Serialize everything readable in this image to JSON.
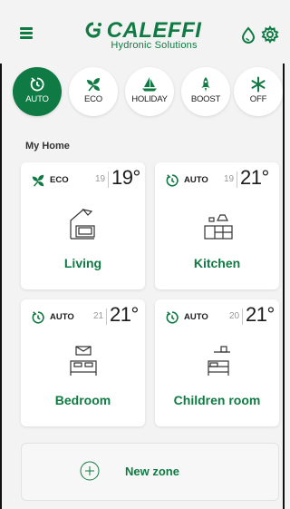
{
  "header": {
    "brand": "CALEFFI",
    "subtitle": "Hydronic Solutions",
    "brand_color": "#0f7a43"
  },
  "modes": [
    {
      "label": "AUTO",
      "icon": "auto-icon",
      "active": true
    },
    {
      "label": "ECO",
      "icon": "eco-icon",
      "active": false
    },
    {
      "label": "HOLIDAY",
      "icon": "sailboat-icon",
      "active": false
    },
    {
      "label": "BOOST",
      "icon": "rocket-icon",
      "active": false
    },
    {
      "label": "OFF",
      "icon": "snowflake-icon",
      "active": false
    }
  ],
  "section": {
    "title": "My Home"
  },
  "zones": [
    {
      "mode": "ECO",
      "mode_icon": "eco-icon",
      "setpoint": "19",
      "temperature": "19°",
      "name": "Living",
      "room_icon": "living-room-icon"
    },
    {
      "mode": "AUTO",
      "mode_icon": "auto-icon",
      "setpoint": "19",
      "temperature": "21°",
      "name": "Kitchen",
      "room_icon": "kitchen-icon"
    },
    {
      "mode": "AUTO",
      "mode_icon": "auto-icon",
      "setpoint": "21",
      "temperature": "21°",
      "name": "Bedroom",
      "room_icon": "bedroom-icon"
    },
    {
      "mode": "AUTO",
      "mode_icon": "auto-icon",
      "setpoint": "20",
      "temperature": "21°",
      "name": "Children room",
      "room_icon": "children-room-icon"
    }
  ],
  "new_zone": {
    "label": "New zone"
  }
}
